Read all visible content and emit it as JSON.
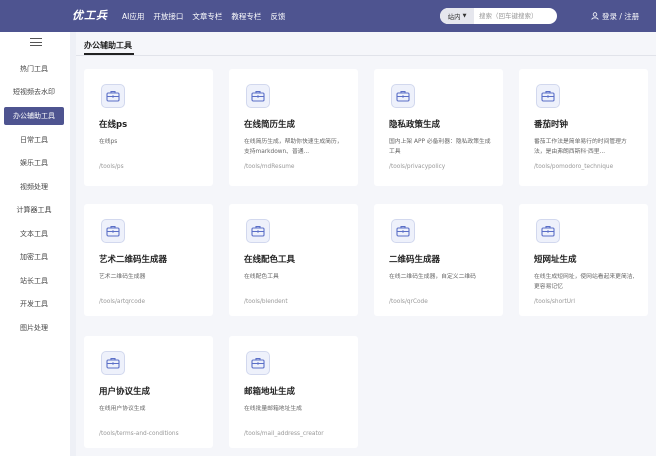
{
  "header": {
    "logo_text": "优工兵",
    "nav": [
      "AI应用",
      "开放接口",
      "文章专栏",
      "教程专栏",
      "反馈"
    ],
    "search": {
      "scope": "站内",
      "placeholder": "搜索（回车键搜索）"
    },
    "login_label": "登录 / 注册"
  },
  "sidebar": {
    "items": [
      {
        "label": "热门工具",
        "active": false
      },
      {
        "label": "短视频去水印",
        "active": false
      },
      {
        "label": "办公辅助工具",
        "active": true
      },
      {
        "label": "日常工具",
        "active": false
      },
      {
        "label": "娱乐工具",
        "active": false
      },
      {
        "label": "视频处理",
        "active": false
      },
      {
        "label": "计算器工具",
        "active": false
      },
      {
        "label": "文本工具",
        "active": false
      },
      {
        "label": "加密工具",
        "active": false
      },
      {
        "label": "站长工具",
        "active": false
      },
      {
        "label": "开发工具",
        "active": false
      },
      {
        "label": "图片处理",
        "active": false
      }
    ]
  },
  "main": {
    "title": "办公辅助工具",
    "cards": [
      {
        "title": "在线ps",
        "desc": "在线ps",
        "path": "/tools/ps",
        "icon": "toolbox-icon"
      },
      {
        "title": "在线简历生成",
        "desc": "在线简历生成，帮助你快速生成简历，支持markdown、普通...",
        "path": "/tools/mdResume",
        "icon": "toolbox-icon"
      },
      {
        "title": "隐私政策生成",
        "desc": "国内上架 APP 必备利器：隐私政策生成工具",
        "path": "/tools/privacypolicy",
        "icon": "toolbox-icon"
      },
      {
        "title": "番茄时钟",
        "desc": "番茄工作法是简单易行的时间管理方法，是由弗朗西斯科·西里...",
        "path": "/tools/pomodoro_technique",
        "icon": "toolbox-icon"
      },
      {
        "title": "艺术二维码生成器",
        "desc": "艺术二维码生成器",
        "path": "/tools/artqrcode",
        "icon": "toolbox-icon"
      },
      {
        "title": "在线配色工具",
        "desc": "在线配色工具",
        "path": "/tools/blendent",
        "icon": "toolbox-icon"
      },
      {
        "title": "二维码生成器",
        "desc": "在线二维码生成器，自定义二维码",
        "path": "/tools/qrCode",
        "icon": "toolbox-icon"
      },
      {
        "title": "短网址生成",
        "desc": "在线生成短网址，使网站看起来更简洁,更容易记忆",
        "path": "/tools/shortUrl",
        "icon": "toolbox-icon"
      },
      {
        "title": "用户协议生成",
        "desc": "在线用户协议生成",
        "path": "/tools/terms-and-conditions",
        "icon": "toolbox-icon"
      },
      {
        "title": "邮箱地址生成",
        "desc": "在线批量邮箱地址生成",
        "path": "/tools/mail_address_creator",
        "icon": "toolbox-icon"
      }
    ]
  },
  "colors": {
    "accent": "#4e5490",
    "background": "#eef0f6",
    "icon_bg": "#eef1fb",
    "icon_stroke": "#5b6fc7"
  }
}
